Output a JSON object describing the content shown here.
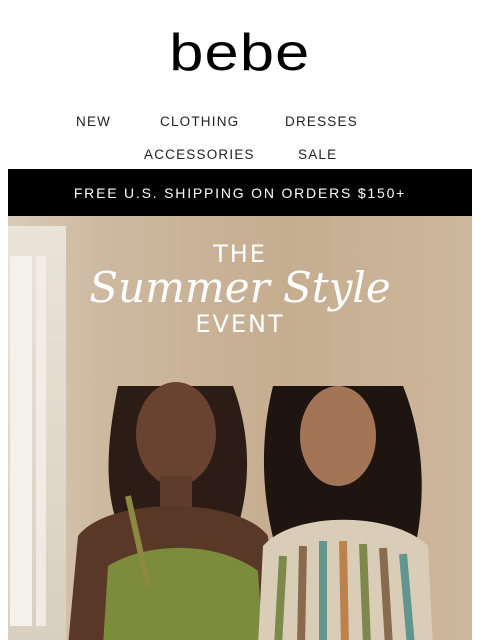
{
  "brand": {
    "logo_text": "bebe"
  },
  "nav": {
    "row1": [
      "NEW",
      "CLOTHING",
      "DRESSES"
    ],
    "row2": [
      "ACCESSORIES",
      "SALE"
    ]
  },
  "banner": {
    "text": "FREE U.S. SHIPPING ON ORDERS $150+"
  },
  "hero": {
    "line1": "THE",
    "line2": "Summer Style",
    "line3": "EVENT"
  },
  "colors": {
    "banner_bg": "#000000",
    "banner_text": "#ffffff",
    "hero_text": "#ffffff",
    "green_top": "#7c8b3c"
  }
}
